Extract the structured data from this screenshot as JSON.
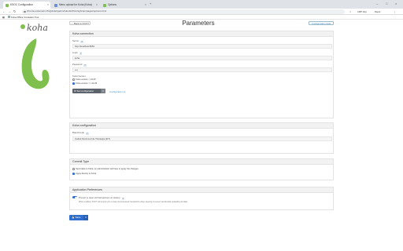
{
  "browser": {
    "tabs": [
      {
        "label": "KSOC Configuration",
        "active": true
      },
      {
        "label": "Menu upload for Koha (Koha)",
        "active": false
      },
      {
        "label": "Options",
        "active": false
      }
    ],
    "url": "chrome-extension://bvjjcbdebgebnvbdoobrdlfmknighzqm/pages/options.html",
    "extensions": [
      "Cl8P Kdp",
      "Rapid"
    ],
    "bookmarks": [
      {
        "label": "Koha Offline Circulation Tool"
      }
    ]
  },
  "header": {
    "back_label": "← Back to KOCT",
    "title": "Parameters",
    "config_data_label": "Configuration data"
  },
  "koha_connection": {
    "heading": "Koha connection",
    "server_label": "Server",
    "server_value": "http://localhost:8081",
    "login_label": "Login",
    "login_value": "koha",
    "password_label": "Password",
    "password_value": "••••",
    "version_label": "Koha Version",
    "version_options": [
      {
        "label": "Koha version < 24.05",
        "selected": false
      },
      {
        "label": "Koha version >= 24.05",
        "selected": true
      }
    ],
    "test_button_label": "Test configuration",
    "status_link": "Configuration ok"
  },
  "koha_configuration": {
    "heading": "Koha configuration",
    "branchcode_label": "Branchcode",
    "branchcode_value": "Institut Florimond de Théologie [IFT]"
  },
  "commit_type": {
    "heading": "Commit Type",
    "options": [
      {
        "label": "Send data to Koha: an administrator will have to apply the changes",
        "selected": false
      },
      {
        "label": "Apply directly to Koha",
        "selected": true
      }
    ]
  },
  "app_prefs": {
    "heading": "Application Preferences",
    "toggle_label": "Prompt to clear old transactions on startup",
    "toggle_on": true,
    "help_text": "When enabled, KOCT will prompt you to clear old processed transactions when opening to prevent accidentally uploading old data."
  },
  "save_label": "Save"
}
